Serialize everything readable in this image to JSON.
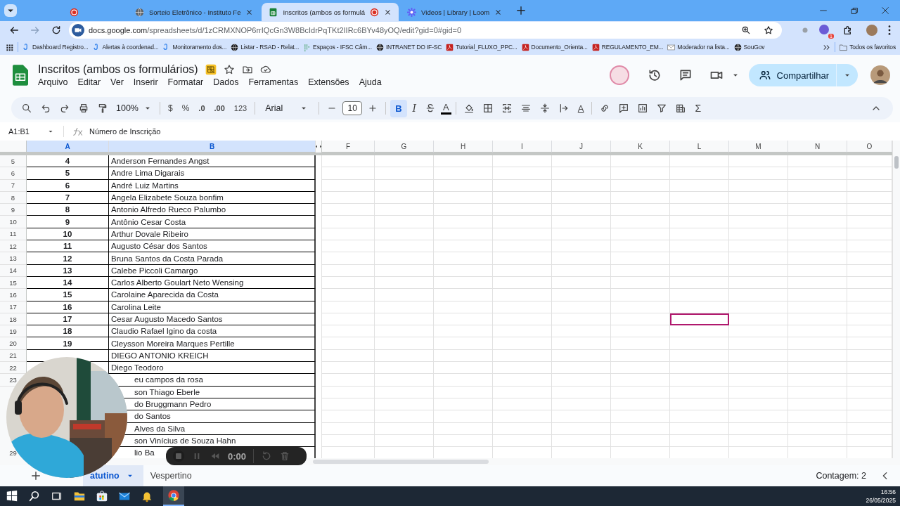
{
  "browser": {
    "tabs": [
      {
        "kind": "recording",
        "selected": false
      },
      {
        "kind": "globe",
        "title": "Sorteio Eletrônico - Instituto Fe",
        "selected": false
      },
      {
        "kind": "sheets",
        "title": "Inscritos (ambos os formulá",
        "selected": true
      },
      {
        "kind": "loom",
        "title": "Videos | Library | Loom",
        "selected": false
      }
    ],
    "url_host": "docs.google.com",
    "url_path": "/spreadsheets/d/1zCRMXNOP6rrIQcGn3W8BcIdrPqTKt2IIRc6BYv48yOQ/edit?gid=0#gid=0",
    "extension_badge": "1",
    "bookmarks": [
      {
        "label": "Dashboard Registro...",
        "kind": "doc"
      },
      {
        "label": "Alertas à coordenad...",
        "kind": "doc"
      },
      {
        "label": "Monitoramento dos...",
        "kind": "doc"
      },
      {
        "label": "Listar - RSAD - Relat...",
        "kind": "globe"
      },
      {
        "label": "Espaços - IFSC Câm...",
        "kind": "grid"
      },
      {
        "label": "INTRANET DO IF-SC",
        "kind": "globe"
      },
      {
        "label": "Tutorial_FLUXO_PPC...",
        "kind": "pdf"
      },
      {
        "label": "Documento_Orienta...",
        "kind": "pdf"
      },
      {
        "label": "REGULAMENTO_EM...",
        "kind": "pdf"
      },
      {
        "label": "Moderador na lista...",
        "kind": "mail"
      },
      {
        "label": "SouGov",
        "kind": "globe"
      }
    ],
    "all_bookmarks": "Todos os favoritos"
  },
  "sheet": {
    "title": "Inscritos (ambos os formulários)",
    "menus": [
      "Arquivo",
      "Editar",
      "Ver",
      "Inserir",
      "Formatar",
      "Dados",
      "Ferramentas",
      "Extensões",
      "Ajuda"
    ],
    "share": "Compartilhar",
    "toolbar": {
      "zoom": "100%",
      "currency": "$",
      "percent": "%",
      "decrease_decimals": ".0",
      "increase_decimals": ".00",
      "number_format": "123",
      "font": "Arial",
      "font_size": "10",
      "bold": {
        "label": "B",
        "selected": true
      },
      "italic": "I",
      "text_color": "A",
      "text_rotation": "A",
      "functions": "Σ"
    },
    "name_box": "A1:B1",
    "formula": "Número de Inscrição",
    "columns": [
      {
        "label": "A",
        "selected": true,
        "cursor": false
      },
      {
        "label": "B",
        "selected": true,
        "cursor": false
      },
      {
        "label": "F",
        "selected": false,
        "cursor": false
      },
      {
        "label": "G",
        "selected": false,
        "cursor": false
      },
      {
        "label": "H",
        "selected": false,
        "cursor": false
      },
      {
        "label": "I",
        "selected": false,
        "cursor": false
      },
      {
        "label": "J",
        "selected": false,
        "cursor": false
      },
      {
        "label": "K",
        "selected": false,
        "cursor": false
      },
      {
        "label": "L",
        "selected": false,
        "cursor": true
      },
      {
        "label": "M",
        "selected": false,
        "cursor": false
      },
      {
        "label": "N",
        "selected": false,
        "cursor": false
      },
      {
        "label": "O",
        "selected": false,
        "cursor": false
      }
    ],
    "rows": [
      {
        "num": "5",
        "a": "4",
        "b": "Anderson Fernandes Angst",
        "kind": "plain",
        "selected": false
      },
      {
        "num": "6",
        "a": "5",
        "b": "Andre Lima Digarais",
        "kind": "plain",
        "selected": false
      },
      {
        "num": "7",
        "a": "6",
        "b": "André Luiz Martins",
        "kind": "plain",
        "selected": false
      },
      {
        "num": "8",
        "a": "7",
        "b": "Angela Elizabete Souza bonfim",
        "kind": "plain",
        "selected": false
      },
      {
        "num": "9",
        "a": "8",
        "b": "Antonio Alfredo Rueco Palumbo",
        "kind": "plain",
        "selected": false
      },
      {
        "num": "10",
        "a": "9",
        "b": "Antônio Cesar Costa",
        "kind": "plain",
        "selected": false
      },
      {
        "num": "11",
        "a": "10",
        "b": "Arthur Dovale Ribeiro",
        "kind": "plain",
        "selected": false
      },
      {
        "num": "12",
        "a": "11",
        "b": "Augusto César dos Santos",
        "kind": "plain",
        "selected": false
      },
      {
        "num": "13",
        "a": "12",
        "b": "Bruna Santos da Costa Parada",
        "kind": "plain",
        "selected": false
      },
      {
        "num": "14",
        "a": "13",
        "b": "Calebe Piccoli Camargo",
        "kind": "plain",
        "selected": false
      },
      {
        "num": "15",
        "a": "14",
        "b": "Carlos Alberto Goulart Neto Wensing",
        "kind": "plain",
        "selected": false
      },
      {
        "num": "16",
        "a": "15",
        "b": "Carolaine Aparecida da Costa",
        "kind": "plain",
        "selected": false
      },
      {
        "num": "17",
        "a": "16",
        "b": "Carolina Leite",
        "kind": "plain",
        "selected": false
      },
      {
        "num": "18",
        "a": "17",
        "b": "Cesar Augusto Macedo Santos",
        "kind": "plain",
        "selected": true
      },
      {
        "num": "19",
        "a": "18",
        "b": "Claudio Rafael Igino da costa",
        "kind": "plain",
        "selected": false
      },
      {
        "num": "20",
        "a": "19",
        "b": "Cleysson Moreira Marques Pertille",
        "kind": "plain",
        "selected": false
      },
      {
        "num": "21",
        "b": "DIEGO ANTONIO KREICH",
        "kind": "plain",
        "selected": false
      },
      {
        "num": "22",
        "b": "Diego Teodoro",
        "kind": "plain",
        "selected": false
      },
      {
        "num": "23",
        "b": "eu campos da rosa",
        "kind": "covered",
        "selected": false
      },
      {
        "b": "son Thiago Eberle",
        "kind": "covered",
        "selected": false
      },
      {
        "b": "do Bruggmann Pedro",
        "kind": "covered",
        "selected": false
      },
      {
        "b": "do Santos",
        "kind": "covered",
        "selected": false
      },
      {
        "b": "Alves da Silva",
        "kind": "covered",
        "selected": false
      },
      {
        "b": "son Vinícius de Souza Hahn",
        "kind": "covered",
        "selected": false
      },
      {
        "num": "29",
        "b": "lio Ba",
        "kind": "covered",
        "selected": false
      }
    ],
    "sheet_tabs": [
      {
        "label": "atutino",
        "selected": true
      },
      {
        "label": "Vespertino",
        "selected": false
      }
    ],
    "status": "Contagem: 2"
  },
  "recorder": {
    "time": "0:00"
  },
  "taskbar": {
    "time": "16:56",
    "date": "26/05/2025"
  }
}
